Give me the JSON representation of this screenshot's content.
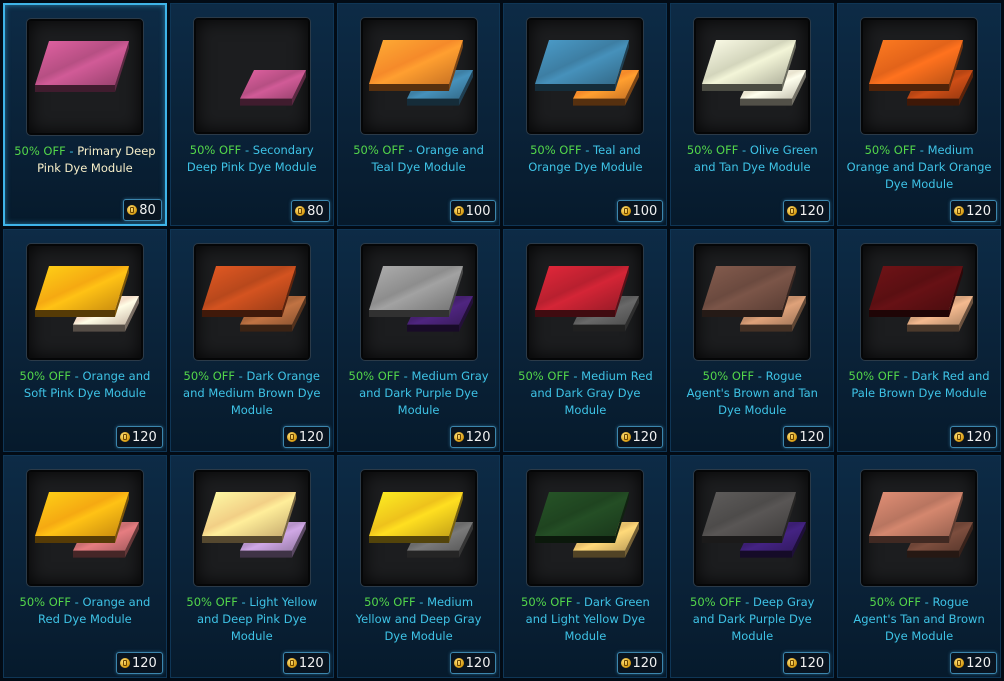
{
  "discount_label": "50% OFF",
  "separator": " - ",
  "currency_icon": "cartel-coin-icon",
  "colors": {
    "discount": "#53d64a",
    "item_name": "#3ec3e6",
    "selected_name": "#f6eec8",
    "selected_border": "#3fb4e8"
  },
  "items": [
    {
      "name": "Primary Deep Pink Dye Module",
      "price": "80",
      "selected": true,
      "primary": "#b64f83",
      "secondary": null
    },
    {
      "name": "Secondary Deep Pink Dye Module",
      "price": "80",
      "selected": false,
      "primary": null,
      "secondary": "#b64f83"
    },
    {
      "name": "Orange and Teal Dye Module",
      "price": "100",
      "selected": false,
      "primary": "#f58a2a",
      "secondary": "#3d7ea3"
    },
    {
      "name": "Teal and Orange Dye Module",
      "price": "100",
      "selected": false,
      "primary": "#3d7ea3",
      "secondary": "#f58a2a"
    },
    {
      "name": "Olive Green and Tan Dye Module",
      "price": "120",
      "selected": false,
      "primary": "#d3d5bc",
      "secondary": "#e9e4cf"
    },
    {
      "name": "Medium Orange and Dark Orange Dye Module",
      "price": "120",
      "selected": false,
      "primary": "#e2631a",
      "secondary": "#b44413"
    },
    {
      "name": "Orange and Soft Pink Dye Module",
      "price": "120",
      "selected": false,
      "primary": "#f5a912",
      "secondary": "#f4dcc8"
    },
    {
      "name": "Dark Orange and Medium Brown Dye Module",
      "price": "120",
      "selected": false,
      "primary": "#b8481c",
      "secondary": "#a8643a"
    },
    {
      "name": "Medium Gray and Dark Purple Dye Module",
      "price": "120",
      "selected": false,
      "primary": "#8d8d8d",
      "secondary": "#45206f"
    },
    {
      "name": "Medium Red and Dark Gray Dye Module",
      "price": "120",
      "selected": false,
      "primary": "#b8202f",
      "secondary": "#5b5b5b"
    },
    {
      "name": "Rogue Agent's Brown and Tan Dye Module",
      "price": "120",
      "selected": false,
      "primary": "#6b4a3f",
      "secondary": "#c28d6a"
    },
    {
      "name": "Dark Red and Pale Brown Dye Module",
      "price": "120",
      "selected": false,
      "primary": "#5a0f12",
      "secondary": "#d5a27c"
    },
    {
      "name": "Orange and Red Dye Module",
      "price": "120",
      "selected": false,
      "primary": "#f5a912",
      "secondary": "#c86d70"
    },
    {
      "name": "Light Yellow and Deep Pink Dye Module",
      "price": "120",
      "selected": false,
      "primary": "#f2cf86",
      "secondary": "#b592c8"
    },
    {
      "name": "Medium Yellow and Deep Gray Dye Module",
      "price": "120",
      "selected": false,
      "primary": "#eec21c",
      "secondary": "#6a6a6a"
    },
    {
      "name": "Dark Green and Light Yellow Dye Module",
      "price": "120",
      "selected": false,
      "primary": "#1f4420",
      "secondary": "#e6be6a"
    },
    {
      "name": "Deep Gray and Dark Purple Dye Module",
      "price": "120",
      "selected": false,
      "primary": "#4d4b4a",
      "secondary": "#3b1e72"
    },
    {
      "name": "Rogue Agent's Tan and Brown Dye Module",
      "price": "120",
      "selected": false,
      "primary": "#b87560",
      "secondary": "#6d4436"
    }
  ]
}
